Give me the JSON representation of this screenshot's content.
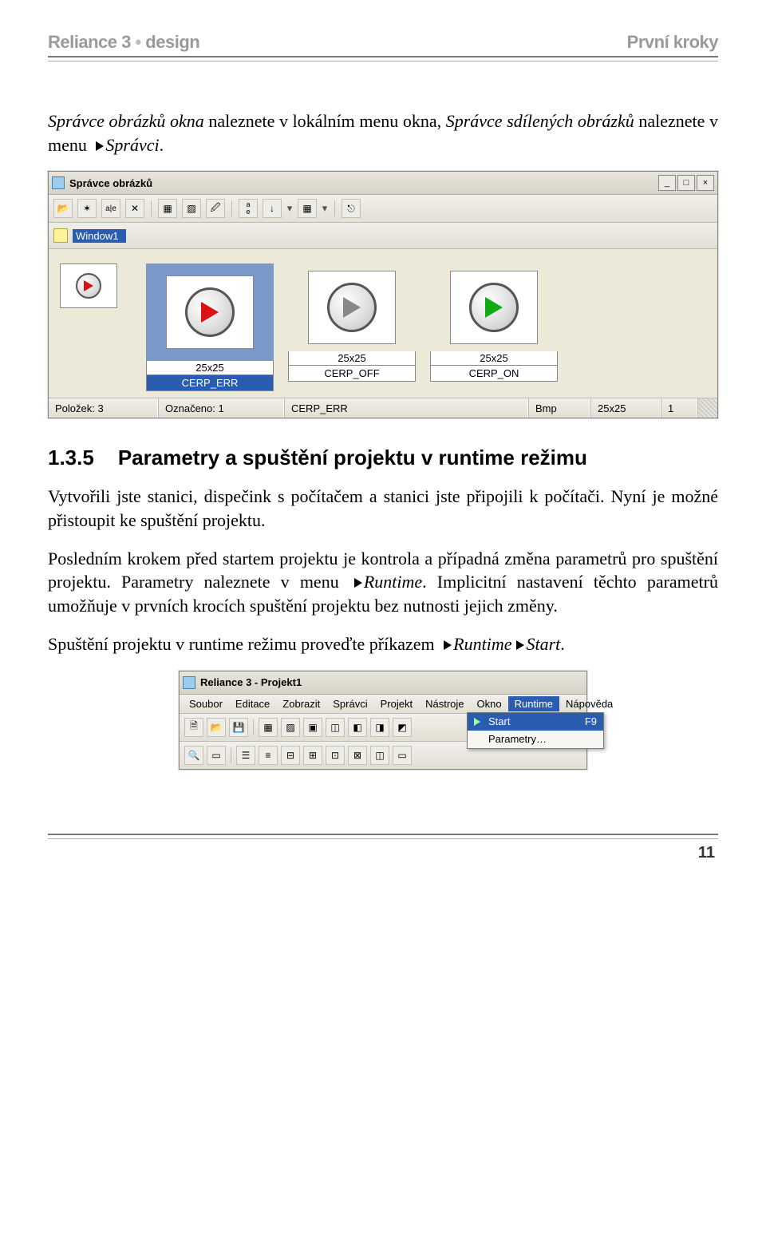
{
  "header": {
    "left_a": "Reliance 3",
    "sep": "•",
    "left_b": "design",
    "right": "První kroky"
  },
  "intro": {
    "seg1": "Správce obrázků okna",
    "seg2": " naleznete v lokálním menu okna, ",
    "seg3": "Správce sdílených obrázků",
    "seg4": " naleznete v menu ",
    "seg5": "Správci",
    "seg6": "."
  },
  "shot1": {
    "title": "Správce obrázků",
    "tree_item": "Window1",
    "thumbs": [
      {
        "size": "25x25",
        "name": "CERP_ERR",
        "color": "red",
        "selected": true
      },
      {
        "size": "25x25",
        "name": "CERP_OFF",
        "color": "gray",
        "selected": false
      },
      {
        "size": "25x25",
        "name": "CERP_ON",
        "color": "green",
        "selected": false
      }
    ],
    "status": {
      "count_label": "Položek:",
      "count": "3",
      "sel_label": "Označeno:",
      "sel": "1",
      "name": "CERP_ERR",
      "type": "Bmp",
      "size": "25x25",
      "extra": "1"
    }
  },
  "section": {
    "num": "1.3.5",
    "title": "Parametry a spuštění projektu v runtime režimu"
  },
  "para1": "Vytvořili jste stanici, dispečink s počítačem a stanici jste připojili k počítači. Nyní je možné přistoupit ke spuštění projektu.",
  "para2": {
    "a": "Posledním krokem před startem projektu je kontrola a případná změna parametrů pro spuštění projektu. Parametry naleznete v menu ",
    "b": "Runtime",
    "c": ". Implicitní nastavení těchto parametrů umožňuje v prvních krocích spuštění projektu bez nutnosti jejich změny."
  },
  "para3": {
    "a": "Spuštění projektu v runtime režimu proveďte příkazem ",
    "b": "Runtime",
    "c": "Start",
    "d": "."
  },
  "shot2": {
    "title": "Reliance 3 - Projekt1",
    "menus": [
      "Soubor",
      "Editace",
      "Zobrazit",
      "Správci",
      "Projekt",
      "Nástroje",
      "Okno",
      "Runtime",
      "Nápověda"
    ],
    "menu_hi_index": 7,
    "popup": [
      {
        "label": "Start",
        "shortcut": "F9",
        "hi": true,
        "icon": "play"
      },
      {
        "label": "Parametry…",
        "shortcut": "",
        "hi": false,
        "icon": ""
      }
    ]
  },
  "page_number": "11"
}
